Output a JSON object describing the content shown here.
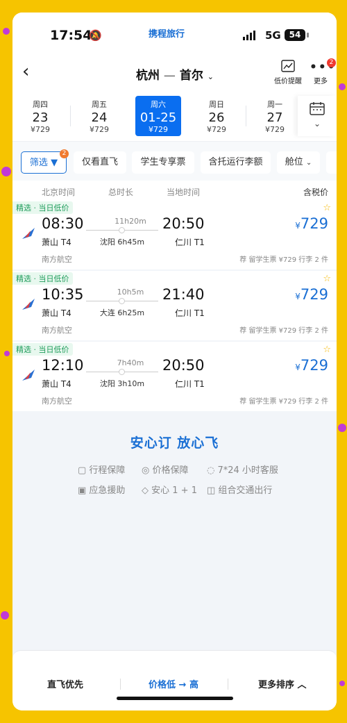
{
  "status": {
    "time": "17:54",
    "brand": "携程旅行",
    "network": "5G",
    "battery": "54"
  },
  "nav": {
    "route_from": "杭州",
    "route_sep": "—",
    "route_to": "首尔",
    "price_alert_label": "低价提醒",
    "more_label": "更多",
    "more_badge": "2"
  },
  "dates": [
    {
      "weekday": "周四",
      "date": "23",
      "price": "¥729"
    },
    {
      "weekday": "周五",
      "date": "24",
      "price": "¥729"
    },
    {
      "weekday": "周六",
      "date": "01-25",
      "price": "¥729",
      "active": true
    },
    {
      "weekday": "周日",
      "date": "26",
      "price": "¥729"
    },
    {
      "weekday": "周一",
      "date": "27",
      "price": "¥729"
    }
  ],
  "filters": {
    "filter_label": "筛选",
    "filter_badge": "2",
    "chips": [
      "仅看直飞",
      "学生专享票",
      "含托运行李额",
      "舱位"
    ]
  },
  "list_header": {
    "beijing_time": "北京时间",
    "duration": "总时长",
    "local_time": "当地时间",
    "tax_price": "含税价"
  },
  "flights": [
    {
      "tag": "精选 · 当日低价",
      "dep_time": "08:30",
      "dep_terminal": "萧山 T4",
      "duration": "11h20m",
      "stop": "沈阳 6h45m",
      "arr_time": "20:50",
      "arr_terminal": "仁川 T1",
      "price_symbol": "¥",
      "price": "729",
      "airline": "南方航空",
      "note": "荐 留学生票 ¥729 行李 2 件"
    },
    {
      "tag": "精选 · 当日低价",
      "dep_time": "10:35",
      "dep_terminal": "萧山 T4",
      "duration": "10h5m",
      "stop": "大连 6h25m",
      "arr_time": "21:40",
      "arr_terminal": "仁川 T1",
      "price_symbol": "¥",
      "price": "729",
      "airline": "南方航空",
      "note": "荐 留学生票 ¥729 行李 2 件"
    },
    {
      "tag": "精选 · 当日低价",
      "dep_time": "12:10",
      "dep_terminal": "萧山 T4",
      "duration": "7h40m",
      "stop": "沈阳 3h10m",
      "arr_time": "20:50",
      "arr_terminal": "仁川 T1",
      "price_symbol": "¥",
      "price": "729",
      "airline": "南方航空",
      "note": "荐 留学生票 ¥729 行李 2 件"
    }
  ],
  "assurance": {
    "title": "安心订 放心飞",
    "items": [
      "行程保障",
      "价格保障",
      "7*24 小时客服",
      "应急援助",
      "安心 1 + 1",
      "组合交通出行"
    ]
  },
  "sort": {
    "direct_first": "直飞优先",
    "price_low_high": "价格低 → 高",
    "more_sort": "更多排序"
  },
  "colors": {
    "accent": "#1a6fd4",
    "active_date": "#0a6ef0",
    "tag_green": "#1e9c5a",
    "badge_red": "#f03a2f"
  }
}
